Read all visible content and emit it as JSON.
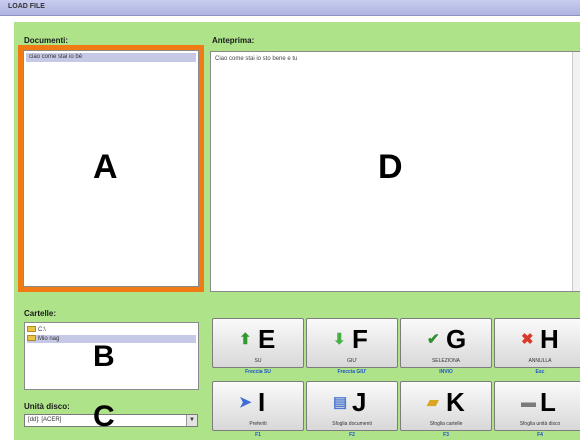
{
  "window": {
    "title": "LOAD FILE"
  },
  "labels": {
    "documents": "Documenti:",
    "preview": "Anteprima:",
    "folders": "Cartelle:",
    "drive": "Unità disco:"
  },
  "documents": {
    "items": [
      "ciao come stai io bé"
    ]
  },
  "preview": {
    "text": "Ciao come stai io sto bene e tu"
  },
  "folders": {
    "items": [
      "C:\\",
      "Mio nag"
    ]
  },
  "drive": {
    "selected": "[dd]: [ACER]"
  },
  "markers": {
    "a": "A",
    "b": "B",
    "c": "C",
    "d": "D"
  },
  "buttons": [
    {
      "letter": "E",
      "icon": "up-arrow-icon",
      "label": "SU",
      "shortcut": "Freccia SU",
      "color": "#2f9a2f"
    },
    {
      "letter": "F",
      "icon": "down-arrow-icon",
      "label": "GIU'",
      "shortcut": "Freccia GIU'",
      "color": "#45b045"
    },
    {
      "letter": "G",
      "icon": "check-icon",
      "label": "SELEZIONA",
      "shortcut": "INVIO",
      "color": "#2f8f2f"
    },
    {
      "letter": "H",
      "icon": "cross-icon",
      "label": "ANNULLA",
      "shortcut": "Esc",
      "color": "#d83a2a"
    },
    {
      "letter": "I",
      "icon": "pointer-icon",
      "label": "Preferiti",
      "shortcut": "F1",
      "color": "#3b6fd6"
    },
    {
      "letter": "J",
      "icon": "document-icon",
      "label": "Sfoglia documenti",
      "shortcut": "F2",
      "color": "#4d7ad0"
    },
    {
      "letter": "K",
      "icon": "folder-icon",
      "label": "Sfoglia cartelle",
      "shortcut": "F3",
      "color": "#d9a623"
    },
    {
      "letter": "L",
      "icon": "drive-icon",
      "label": "Sfoglia unità disco",
      "shortcut": "F4",
      "color": "#7a7a7a"
    }
  ]
}
